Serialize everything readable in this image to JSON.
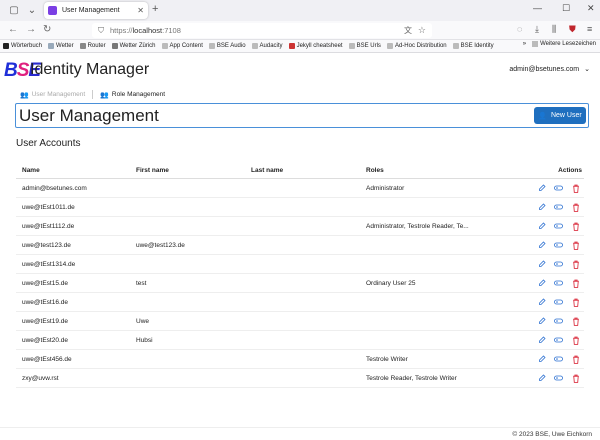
{
  "browser": {
    "tab_title": "User Management",
    "url_prefix": "https://",
    "url_host": "localhost",
    "url_port": ":7108",
    "bookmarks": [
      "Wörterbuch",
      "Wetter",
      "Router",
      "Wetter Zürich",
      "App Content",
      "BSE Audio",
      "Audacity",
      "Jekyll cheatsheet",
      "BSE Urls",
      "Ad-Hoc Distribution",
      "BSE Identity"
    ],
    "bookmarks_more": "Weitere Lesezeichen"
  },
  "app": {
    "logo": {
      "b": "B",
      "s": "S",
      "e": "E"
    },
    "title": "Identity Manager",
    "user": "admin@bsetunes.com"
  },
  "breadcrumb": [
    {
      "label": "User Management",
      "active": false
    },
    {
      "label": "Role Management",
      "active": true
    }
  ],
  "page": {
    "title": "User Management",
    "new_user_label": "New User",
    "section_title": "User Accounts"
  },
  "table": {
    "headers": {
      "name": "Name",
      "first": "First name",
      "last": "Last name",
      "roles": "Roles",
      "actions": "Actions"
    },
    "rows": [
      {
        "name": "admin@bsetunes.com",
        "first": "",
        "last": "",
        "roles": "Administrator"
      },
      {
        "name": "uwe@tEst1011.de",
        "first": "",
        "last": "",
        "roles": ""
      },
      {
        "name": "uwe@tEst1112.de",
        "first": "",
        "last": "",
        "roles": "Administrator, Testrole Reader, Te..."
      },
      {
        "name": "uwe@test123.de",
        "first": "uwe@test123.de",
        "last": "",
        "roles": ""
      },
      {
        "name": "uwe@tEst1314.de",
        "first": "",
        "last": "",
        "roles": ""
      },
      {
        "name": "uwe@tEst15.de",
        "first": "test",
        "last": "",
        "roles": "Ordinary User 25"
      },
      {
        "name": "uwe@tEst16.de",
        "first": "",
        "last": "",
        "roles": ""
      },
      {
        "name": "uwe@tEst19.de",
        "first": "Uwe",
        "last": "",
        "roles": ""
      },
      {
        "name": "uwe@tEst20.de",
        "first": "Hubsi",
        "last": "",
        "roles": ""
      },
      {
        "name": "uwe@tEst456.de",
        "first": "",
        "last": "",
        "roles": "Testrole Writer"
      },
      {
        "name": "zxy@uvw.rst",
        "first": "",
        "last": "",
        "roles": "Testrole Reader, Testrole Writer"
      }
    ]
  },
  "footer": "© 2023 BSE, Uwe Eichkorn"
}
